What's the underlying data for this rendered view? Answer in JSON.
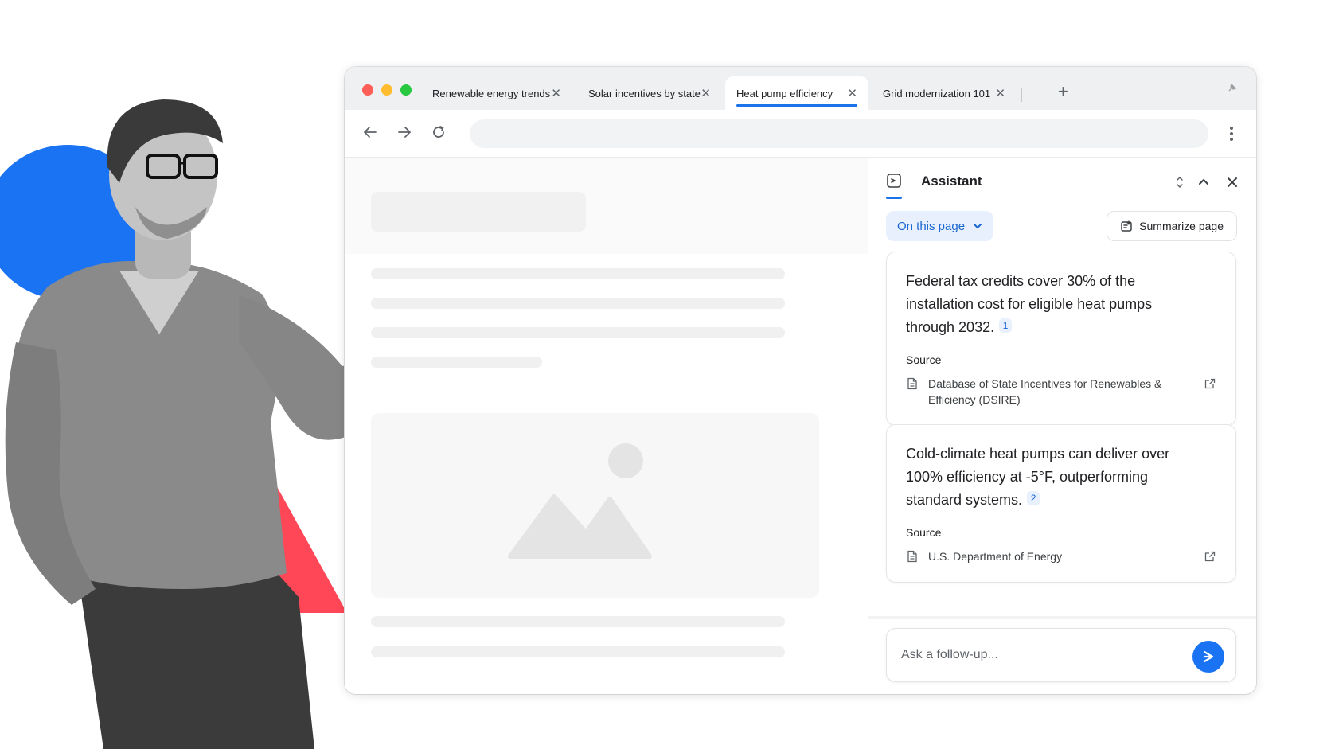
{
  "browser": {
    "tabs": [
      {
        "label": "Renewable energy trends",
        "active": false
      },
      {
        "label": "Solar incentives by state",
        "active": false
      },
      {
        "label": "Heat pump efficiency",
        "active": true
      },
      {
        "label": "Grid modernization 101",
        "active": false
      }
    ]
  },
  "assistant": {
    "title": "Assistant",
    "scope_label": "On this page",
    "summarize_label": "Summarize page",
    "cards": [
      {
        "text": "Federal tax credits cover 30% of the installation cost for eligible heat pumps through 2032.",
        "citation": "1",
        "source_label": "Source",
        "source": "Database of State Incentives for Renewables & Efficiency (DSIRE)"
      },
      {
        "text": "Cold-climate heat pumps can deliver over 100% efficiency at -5°F, outperforming standard systems.",
        "citation": "2",
        "source_label": "Source",
        "source": "U.S. Department of Energy"
      }
    ],
    "input_placeholder": "Ask a follow-up..."
  },
  "colors": {
    "accent": "#1a73e8",
    "send_button": "#1a73f2",
    "decor_blue": "#1a73f2",
    "decor_red": "#ff4757"
  }
}
